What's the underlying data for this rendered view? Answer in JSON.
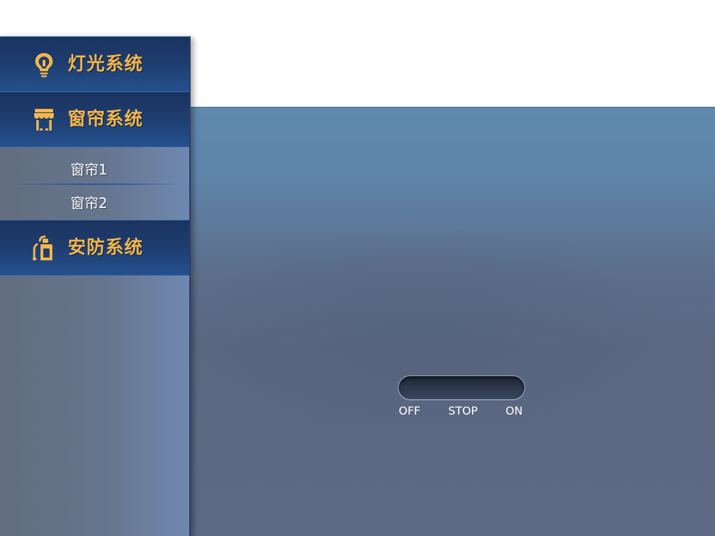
{
  "sidebar": {
    "categories": [
      {
        "label": "灯光系统",
        "icon": "lightbulb-icon"
      },
      {
        "label": "窗帘系统",
        "icon": "storefront-awning-icon"
      },
      {
        "label": "安防系统",
        "icon": "fire-extinguisher-icon"
      }
    ],
    "curtain_submenu": [
      {
        "label": "窗帘1"
      },
      {
        "label": "窗帘2"
      }
    ]
  },
  "control": {
    "off_label": "OFF",
    "stop_label": "STOP",
    "on_label": "ON"
  },
  "colors": {
    "category_text": "#f3b64c",
    "category_bg": "#1e3c6d",
    "panel_bg": "#5f86aa"
  }
}
